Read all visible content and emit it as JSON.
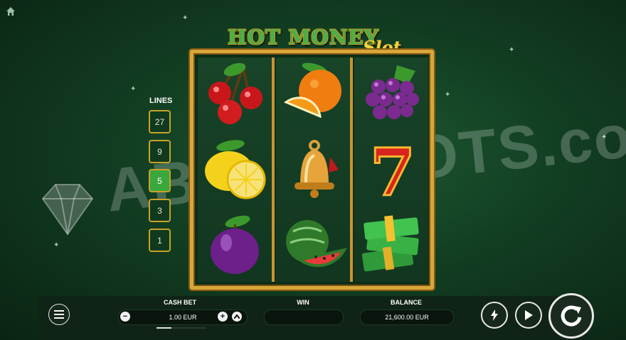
{
  "watermark": "ABOUTSLOTS.com",
  "logo": {
    "main": "HOT MONEY",
    "sub": "Slot"
  },
  "lines": {
    "label": "LINES",
    "options": [
      "27",
      "9",
      "5",
      "3",
      "1"
    ],
    "selected": "5"
  },
  "reels": [
    {
      "symbols": [
        "cherries",
        "lemon",
        "plum"
      ]
    },
    {
      "symbols": [
        "orange",
        "bell",
        "watermelon"
      ]
    },
    {
      "symbols": [
        "grapes",
        "seven",
        "cash-stack"
      ]
    }
  ],
  "seven_label": "7",
  "bottom": {
    "cash_bet_label": "CASH BET",
    "cash_bet_value": "1.00 EUR",
    "bet_level_fraction": 0.3,
    "win_label": "WIN",
    "win_value": "",
    "balance_label": "BALANCE",
    "balance_value": "21,600.00 EUR",
    "minus": "−",
    "plus": "+"
  },
  "icons": [
    "home-icon",
    "menu-icon",
    "turbo-icon",
    "autoplay-icon",
    "spin-icon"
  ],
  "colors": {
    "frame_gold": "#d8a63a",
    "active_line": "#3aa83c",
    "background": "#123e22"
  }
}
